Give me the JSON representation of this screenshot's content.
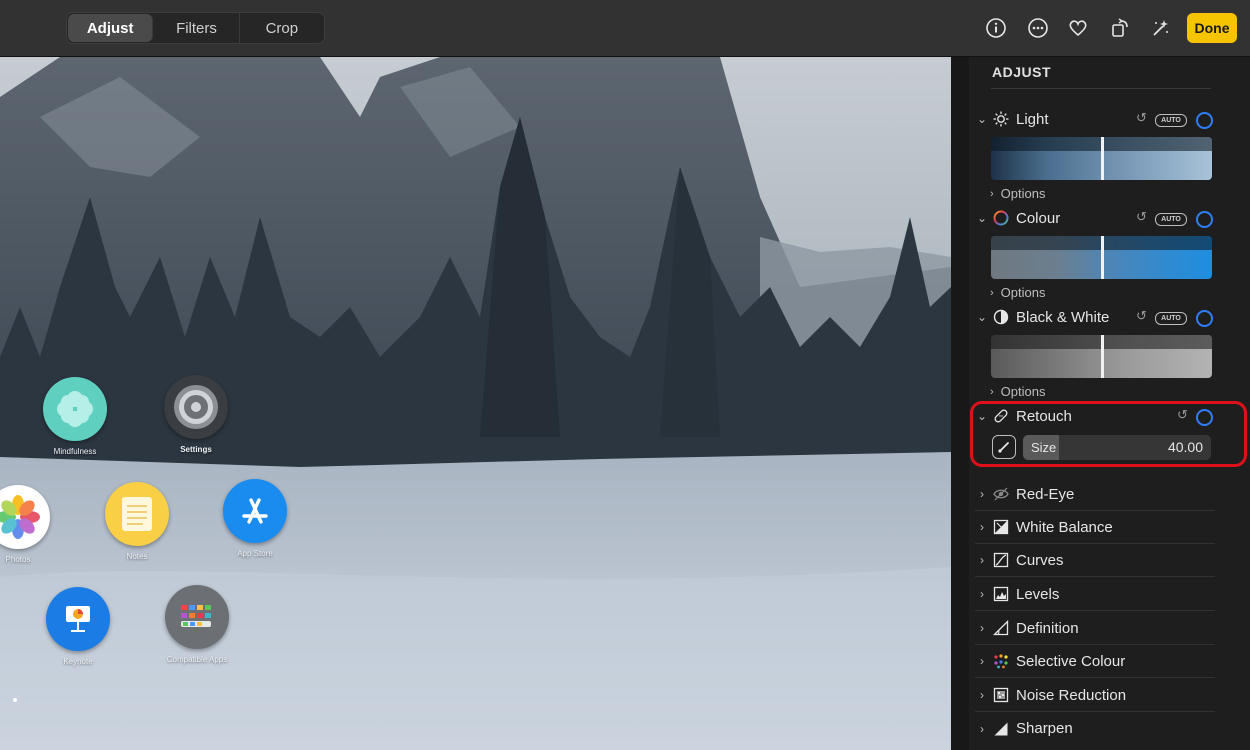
{
  "toolbar": {
    "tabs": [
      {
        "label": "Adjust",
        "active": true
      },
      {
        "label": "Filters",
        "active": false
      },
      {
        "label": "Crop",
        "active": false
      }
    ],
    "icons": [
      "info-icon",
      "more-icon",
      "heart-icon",
      "rotate-icon",
      "magic-wand-icon"
    ],
    "done_label": "Done",
    "accent_color": "#f6c400"
  },
  "photo": {
    "apps": [
      {
        "label": "Mindfulness",
        "icon": "mindfulness-icon"
      },
      {
        "label": "Settings",
        "icon": "settings-gear-icon"
      },
      {
        "label": "Photos",
        "icon": "photos-flower-icon"
      },
      {
        "label": "Notes",
        "icon": "notes-icon"
      },
      {
        "label": "App Store",
        "icon": "app-store-icon"
      },
      {
        "label": "Keynote",
        "icon": "keynote-icon"
      },
      {
        "label": "Compatible Apps",
        "icon": "app-folder-icon"
      }
    ]
  },
  "panel": {
    "title": "ADJUST",
    "auto_label": "AUTO",
    "options_label": "Options",
    "sections": [
      {
        "label": "Light",
        "icon": "sun-icon",
        "expanded": true
      },
      {
        "label": "Colour",
        "icon": "colour-wheel-icon",
        "expanded": true
      },
      {
        "label": "Black & White",
        "icon": "half-circle-icon",
        "expanded": true
      },
      {
        "label": "Retouch",
        "icon": "bandage-icon",
        "expanded": true
      }
    ],
    "retouch": {
      "size_label": "Size",
      "size_value": "40.00",
      "highlight_color": "#e0101a"
    },
    "tools": [
      {
        "label": "Red-Eye",
        "icon": "eye-icon"
      },
      {
        "label": "White Balance",
        "icon": "white-balance-icon"
      },
      {
        "label": "Curves",
        "icon": "curves-icon"
      },
      {
        "label": "Levels",
        "icon": "levels-icon"
      },
      {
        "label": "Definition",
        "icon": "definition-icon"
      },
      {
        "label": "Selective Colour",
        "icon": "selective-colour-icon"
      },
      {
        "label": "Noise Reduction",
        "icon": "noise-reduction-icon"
      },
      {
        "label": "Sharpen",
        "icon": "sharpen-icon"
      }
    ]
  }
}
